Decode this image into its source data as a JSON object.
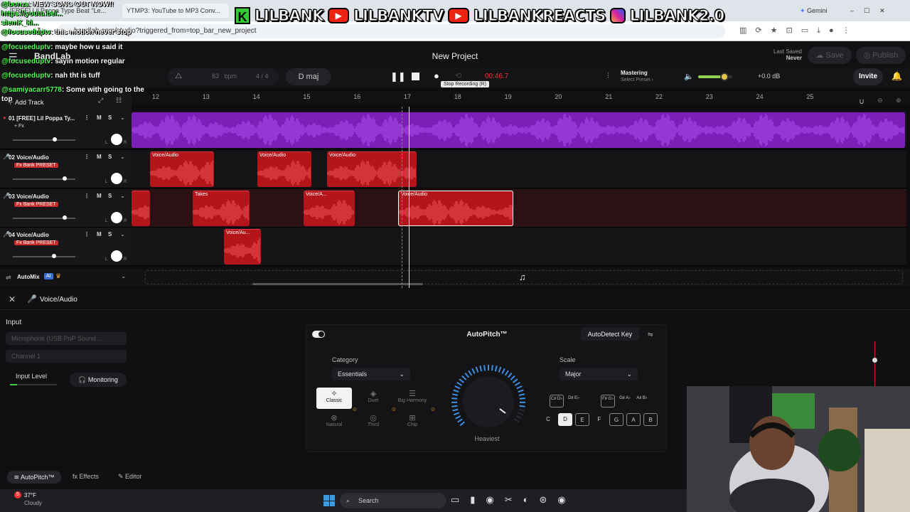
{
  "browser": {
    "tabs": [
      "[FREE] Lil Poppa Type Beat \"Le...",
      "YTMP3: YouTube to MP3 Conv..."
    ],
    "url": "bandlab.com/studio?triggered_from=top_bar_new_project",
    "gemini_label": "Gemini"
  },
  "banner": {
    "k_logo": "K",
    "items": [
      "LILBANK",
      "LILBANKTV",
      "LILBANKREACTS",
      "LILBANK2.0"
    ]
  },
  "chat": [
    {
      "name": "@bonza",
      "text": ": NEW SONG OUT NOW!!"
    },
    {
      "name": "https://youtu.be/...",
      "text": ""
    },
    {
      "name": "siemK_kl...",
      "text": ""
    },
    {
      "name": "@focuseduptv",
      "text": ": this motion never stop"
    },
    {
      "name": "@focuseduptv",
      "text": ": maybe how u said it"
    },
    {
      "name": "@focuseduptv",
      "text": ": sayin motion regular"
    },
    {
      "name": "@focuseduptv",
      "text": ": nah tht is tuff"
    },
    {
      "name": "@samiyacarr5778",
      "text": ": Some with going to the top"
    }
  ],
  "app": {
    "brand": "BandLab",
    "project_title": "New Project",
    "last_saved_label": "Last Saved",
    "last_saved_value": "Never",
    "save_label": "Save",
    "publish_label": "Publish",
    "bpm_value": "83",
    "bpm_unit": "bpm",
    "time_signature": "4 / 4",
    "key": "D maj",
    "time_readout": "00:46.7",
    "tooltip": "Stop Recording (R)",
    "mastering_label": "Mastering",
    "mastering_preset": "Select Preset",
    "volume_db": "+0.0 dB",
    "volume_level": 0.78,
    "invite_label": "Invite",
    "add_track_label": "Add Track",
    "automix_label": "AutoMix",
    "ai_badge": "AI"
  },
  "ruler": [
    "12",
    "13",
    "14",
    "15",
    "16",
    "17",
    "18",
    "19",
    "20",
    "21",
    "22",
    "23",
    "24",
    "25"
  ],
  "tracks": [
    {
      "name": "01 [FREE] Lil Poppa Ty...",
      "badge": "+ Fx",
      "color": "#8a1fd0"
    },
    {
      "name": "02 Voice/Audio",
      "badge": "Fx Bank PRESET",
      "color": "#b3151b"
    },
    {
      "name": "03 Voice/Audio",
      "badge": "Fx Bank PRESET",
      "color": "#b3151b"
    },
    {
      "name": "04 Voice/Audio",
      "badge": "Fx Bank PRESET",
      "color": "#b3151b"
    }
  ],
  "mute_label": "M",
  "solo_label": "S",
  "clip_labels": {
    "voice": "Voice/Audio",
    "takes": "Takes",
    "voice_short": "Voice/A...",
    "voice_short2": "Voice/Au..."
  },
  "panel": {
    "title": "Voice/Audio",
    "input_label": "Input",
    "input_device": "Microphone (USB PnP Sound...",
    "channel": "Channel 1",
    "input_level_label": "Input Level",
    "monitoring_label": "Monitoring"
  },
  "autopitch": {
    "title": "AutoPitch™",
    "autodetect_label": "AutoDetect Key",
    "category_label": "Category",
    "category_value": "Essentials",
    "scale_label": "Scale",
    "scale_value": "Major",
    "knob_label": "Heaviest",
    "modes": [
      "Classic",
      "Duet",
      "Big Harmony",
      "Natural",
      "Third",
      "Chip"
    ],
    "sharp_keys": [
      "C♯ D♭",
      "D♯ E♭",
      "F♯ G♭",
      "G♯ A♭",
      "A♯ B♭"
    ],
    "natural_keys": [
      "C",
      "D",
      "E",
      "F",
      "G",
      "A",
      "B"
    ],
    "selected_key": "D"
  },
  "bottom_tabs": [
    "AutoPitch™",
    "Effects",
    "Editor"
  ],
  "taskbar": {
    "weather_temp": "37°F",
    "weather_desc": "Cloudy",
    "search_label": "Search"
  }
}
